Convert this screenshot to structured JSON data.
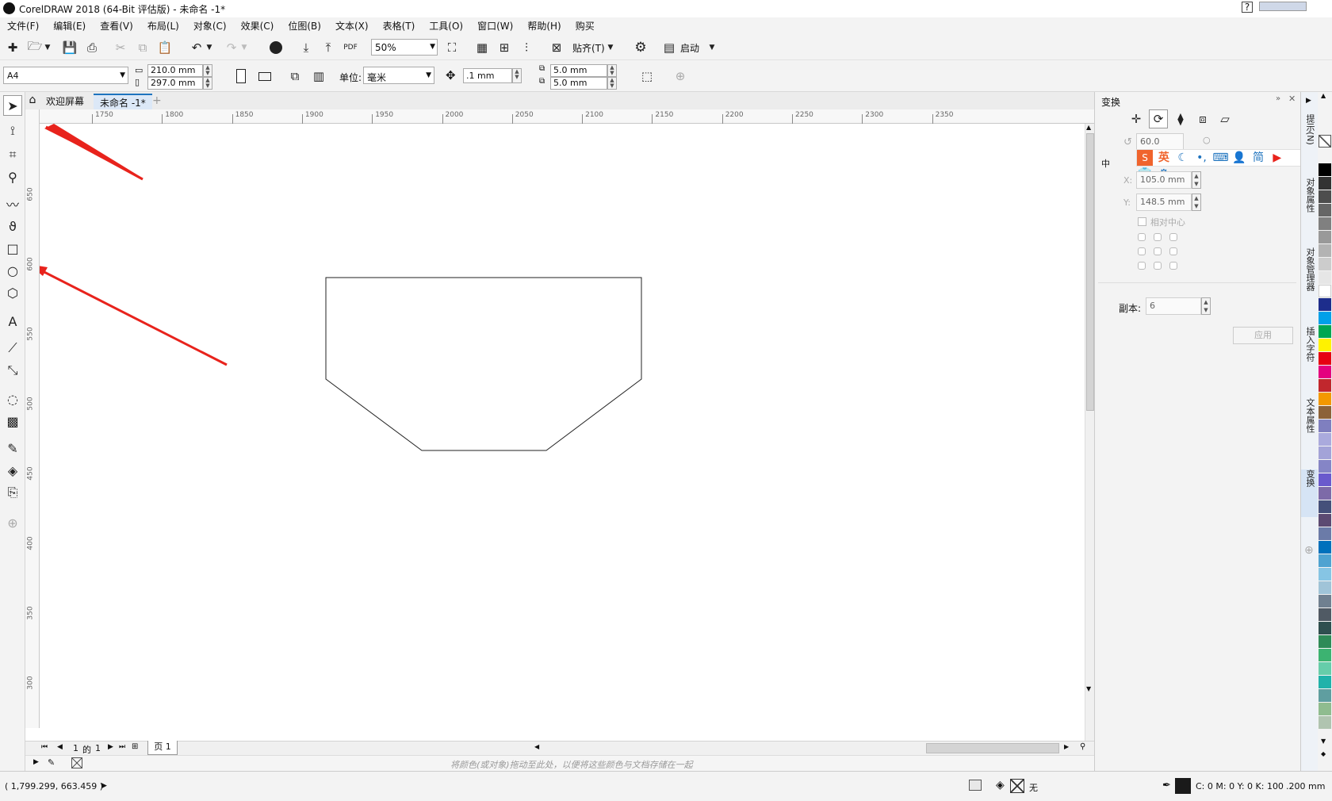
{
  "window": {
    "title": "CorelDRAW 2018 (64-Bit 评估版) - 未命名 -1*"
  },
  "menu": [
    "文件(F)",
    "编辑(E)",
    "查看(V)",
    "布局(L)",
    "对象(C)",
    "效果(C)",
    "位图(B)",
    "文本(X)",
    "表格(T)",
    "工具(O)",
    "窗口(W)",
    "帮助(H)",
    "购买"
  ],
  "toolbar1": {
    "zoom": "50%",
    "snap_label": "贴齐(T)",
    "launch_label": "启动"
  },
  "property_bar": {
    "page_size": "A4",
    "width": "210.0 mm",
    "height": "297.0 mm",
    "units_label": "单位:",
    "units_value": "毫米",
    "nudge": ".1 mm",
    "dup_x": "5.0 mm",
    "dup_y": "5.0 mm"
  },
  "tabs": [
    {
      "label": "欢迎屏幕",
      "active": false
    },
    {
      "label": "未命名 -1*",
      "active": true
    }
  ],
  "ruler": {
    "h_labels": [
      "1750",
      "1800",
      "1850",
      "1900",
      "1950",
      "2000",
      "2050",
      "2100",
      "2150",
      "2200",
      "2250",
      "2300",
      "2350"
    ],
    "v_labels": [
      "650",
      "600",
      "550",
      "500",
      "450",
      "400",
      "350",
      "300"
    ]
  },
  "page_nav": {
    "current": "1",
    "of_label": "的",
    "total": "1",
    "page_tab": "页 1"
  },
  "palette_hint": "将颜色(或对象)拖动至此处，以便将这些颜色与文档存储在一起",
  "status": {
    "coords": "( 1,799.299, 663.459 )",
    "fill_none": "无",
    "color_readout": "C: 0 M: 0 Y: 0 K: 100",
    "stroke_width": ".200 mm"
  },
  "docker": {
    "title": "变换",
    "angle": "60.0",
    "center_label": "中",
    "x_value": "105.0 mm",
    "y_value": "148.5 mm",
    "relative_center": "相对中心",
    "copies_label": "副本:",
    "copies_value": "6",
    "apply_label": "应用",
    "ime": {
      "english": "英",
      "simplified": "简"
    }
  },
  "docker_tabs": [
    "提示(N)",
    "对象属性",
    "对象管理器",
    "插入字符",
    "文本属性",
    "变换"
  ],
  "colors": {
    "palette": [
      "#000000",
      "#333333",
      "#4d4d4d",
      "#666666",
      "#808080",
      "#999999",
      "#b3b3b3",
      "#cccccc",
      "#e6e6e6",
      "#ffffff",
      "#1d2d8c",
      "#00a0e9",
      "#00a651",
      "#fff200",
      "#e60012",
      "#e4007f",
      "#c1272d",
      "#f39800",
      "#8c6239",
      "#7f7fbf",
      "#aaaadd",
      "#a3a3d8",
      "#8585c6",
      "#6a5acd",
      "#7d6aa8",
      "#45507a",
      "#5c4a72",
      "#6b7ba8",
      "#0071bc",
      "#4fa3d1",
      "#86c5e4",
      "#a0c4d8",
      "#708090",
      "#505a64",
      "#2f4f4f",
      "#2e8b57",
      "#3cb371",
      "#66cdaa",
      "#20b2aa",
      "#5f9ea0",
      "#8fbc8f",
      "#b0c4b0"
    ],
    "accent": "#1e73be"
  }
}
